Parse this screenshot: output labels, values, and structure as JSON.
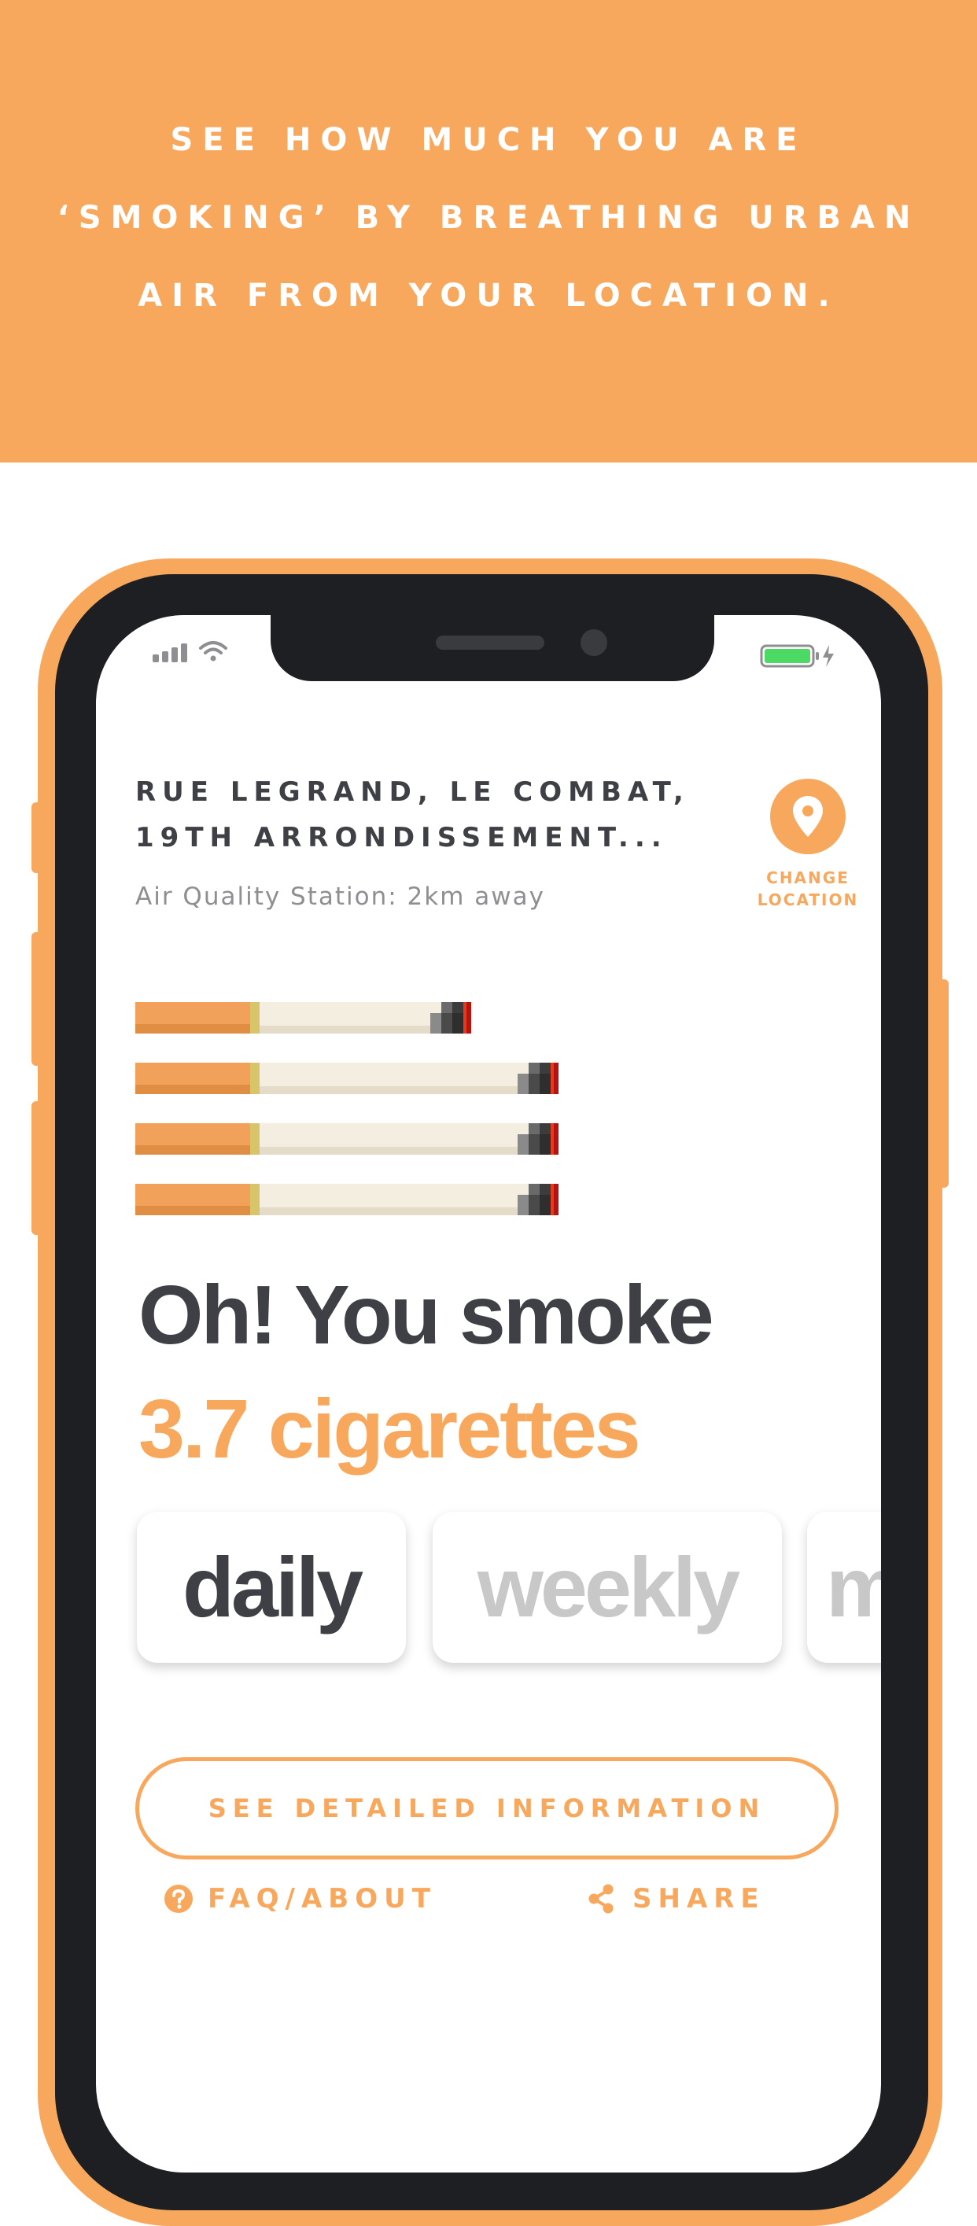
{
  "banner": {
    "line1": "SEE HOW MUCH YOU ARE",
    "line2": "‘SMOKING’ BY BREATHING URBAN",
    "line3": "AIR FROM YOUR LOCATION."
  },
  "colors": {
    "accent": "#F8A85D",
    "text_dark": "#3F4045",
    "text_muted": "#8E8E93",
    "inactive": "#C8C8C8",
    "battery": "#4CD964"
  },
  "status_bar": {
    "signal_icon": "signal-bars-icon",
    "wifi_icon": "wifi-icon",
    "battery_icon": "battery-charging-icon"
  },
  "location": {
    "address_line1": "RUE LEGRAND, LE COMBAT,",
    "address_line2": "19TH ARRONDISSEMENT...",
    "station": "Air Quality Station: 2km away",
    "change_line1": "CHANGE",
    "change_line2": "LOCATION",
    "change_icon": "map-pin-icon"
  },
  "cigarettes": {
    "count": 3.7,
    "partial_fraction": 0.7
  },
  "result": {
    "headline": "Oh! You smoke",
    "amount": "3.7 cigarettes"
  },
  "periods": [
    {
      "label": "daily",
      "selected": true
    },
    {
      "label": "weekly",
      "selected": false
    },
    {
      "label": "monthly",
      "selected": false
    }
  ],
  "actions": {
    "detail_button": "SEE DETAILED INFORMATION",
    "faq": "FAQ/ABOUT",
    "faq_icon": "question-circle-icon",
    "share": "SHARE",
    "share_icon": "share-icon"
  }
}
